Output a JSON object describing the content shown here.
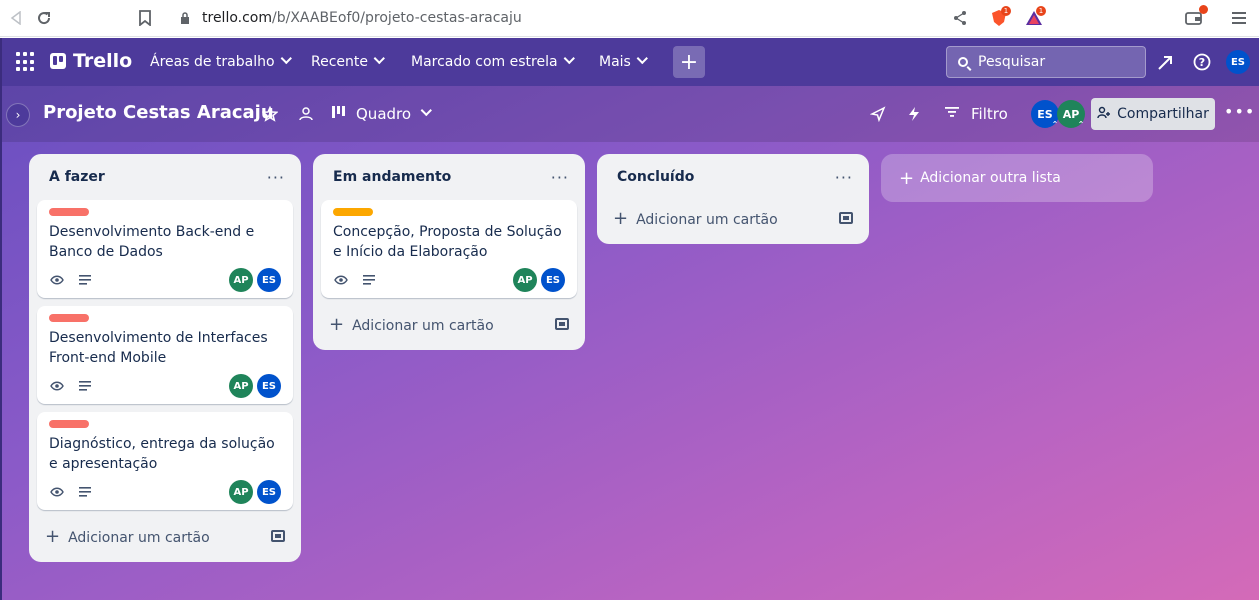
{
  "browser": {
    "url_host": "trello.com",
    "url_path": "/b/XAABEof0/projeto-cestas-aracaju",
    "ext_badge_1": "1",
    "ext_badge_2": "1"
  },
  "topnav": {
    "logo": "Trello",
    "items": [
      {
        "label": "Áreas de trabalho"
      },
      {
        "label": "Recente"
      },
      {
        "label": "Marcado com estrela"
      },
      {
        "label": "Mais"
      }
    ],
    "create": "+",
    "search_placeholder": "Pesquisar",
    "me_initials": "ES"
  },
  "board": {
    "title": "Projeto Cestas Aracaju",
    "view": "Quadro",
    "filter": "Filtro",
    "members": [
      {
        "initials": "ES",
        "color": "#0052cc"
      },
      {
        "initials": "AP",
        "color": "#1f845a"
      }
    ],
    "share": "Compartilhar",
    "add_list": "Adicionar outra lista"
  },
  "lists": [
    {
      "title": "A fazer",
      "add_card": "Adicionar um cartão",
      "cards": [
        {
          "label_color": "#f87168",
          "title": "Desenvolvimento Back-end e Banco de Dados",
          "members": [
            "AP",
            "ES"
          ]
        },
        {
          "label_color": "#f87168",
          "title": "Desenvolvimento de Interfaces Front-end Mobile",
          "members": [
            "AP",
            "ES"
          ]
        },
        {
          "label_color": "#f87168",
          "title": "Diagnóstico, entrega da solução e apresentação",
          "members": [
            "AP",
            "ES"
          ]
        }
      ]
    },
    {
      "title": "Em andamento",
      "add_card": "Adicionar um cartão",
      "cards": [
        {
          "label_color": "#fca700",
          "title": "Concepção, Proposta de Solução e Início da Elaboração",
          "members": [
            "AP",
            "ES"
          ]
        }
      ]
    },
    {
      "title": "Concluído",
      "add_card": "Adicionar um cartão",
      "cards": []
    }
  ],
  "colors": {
    "AP": "#1f845a",
    "ES": "#0052cc"
  }
}
